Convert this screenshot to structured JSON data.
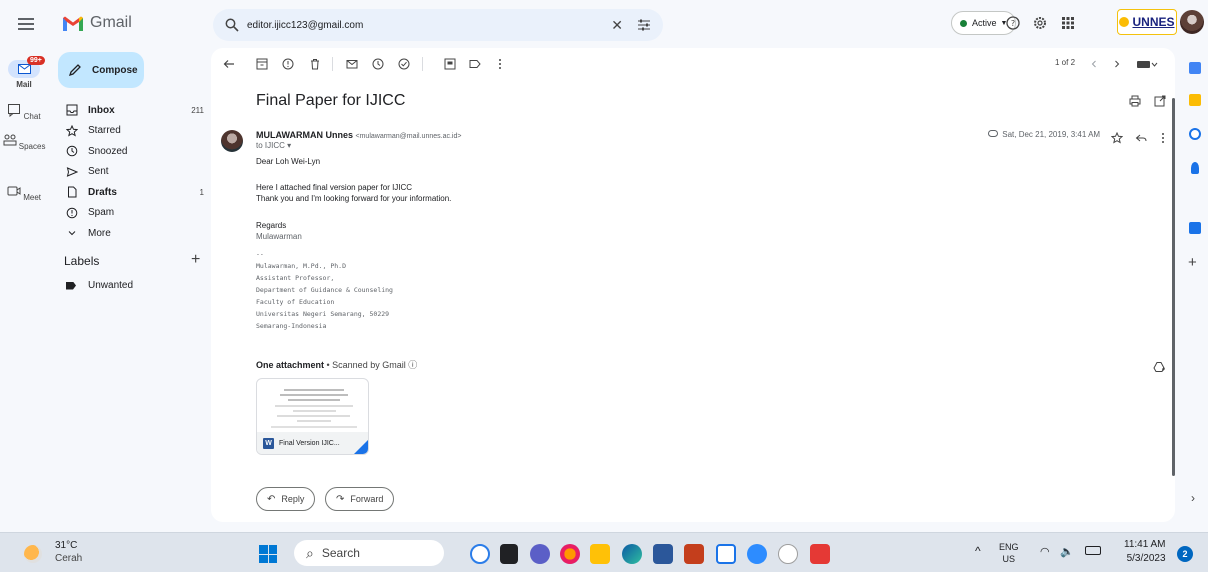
{
  "topbar": {
    "app_name": "Gmail",
    "search_value": "editor.ijicc123@gmail.com",
    "clear_glyph": "✕",
    "status_label": "Active",
    "org_logo": "UNNES"
  },
  "rail": {
    "mail_badge": "99+",
    "items": [
      "Mail",
      "Chat",
      "Spaces",
      "Meet"
    ]
  },
  "nav": {
    "compose_label": "Compose",
    "items": [
      {
        "label": "Inbox",
        "count": "211",
        "icon": "inbox-icon"
      },
      {
        "label": "Starred",
        "count": "",
        "icon": "star-icon"
      },
      {
        "label": "Snoozed",
        "count": "",
        "icon": "clock-icon"
      },
      {
        "label": "Sent",
        "count": "",
        "icon": "send-icon"
      },
      {
        "label": "Drafts",
        "count": "1",
        "icon": "draft-icon"
      },
      {
        "label": "Spam",
        "count": "",
        "icon": "spam-icon"
      },
      {
        "label": "More",
        "count": "",
        "icon": "chevron-down-icon"
      }
    ],
    "labels_heading": "Labels",
    "labels_add": "+",
    "labels": [
      "Unwanted"
    ]
  },
  "message": {
    "pager": "1 of 2",
    "subject": "Final Paper for IJICC",
    "sender_name": "MULAWARMAN Unnes",
    "sender_email": "<mulawarman@mail.unnes.ac.id>",
    "to": "to IJICC ▾",
    "date": "Sat, Dec 21, 2019, 3:41 AM",
    "greeting": "Dear Loh Wei-Lyn",
    "line1": "Here I attached final version paper for IJICC",
    "line2": "Thank you and I'm looking forward for your information.",
    "regards": "Regards",
    "regards_name": "Mulawarman",
    "signature": [
      "--",
      "Mulawarman, M.Pd., Ph.D",
      "Assistant Professor,",
      "Department of Guidance & Counseling",
      "Faculty of Education",
      "Universitas Negeri Semarang, 50229",
      "Semarang-Indonesia"
    ],
    "attachment_heading": "One attachment",
    "attachment_scan": " • Scanned by Gmail ⓘ",
    "attachment_name": "Final Version IJIC...",
    "attachment_type": "W",
    "reply_label": "Reply",
    "forward_label": "Forward"
  },
  "taskbar": {
    "temperature": "31°C",
    "weather": "Cerah",
    "search_label": "Search",
    "lang": "ENG",
    "region": "US",
    "time": "11:41 AM",
    "date": "5/3/2023",
    "notifications": "2"
  },
  "colors": {
    "accent": "#0b57d0",
    "compose_bg": "#c2e7ff",
    "search_bg": "#eaf1fb",
    "active_green": "#188038"
  }
}
